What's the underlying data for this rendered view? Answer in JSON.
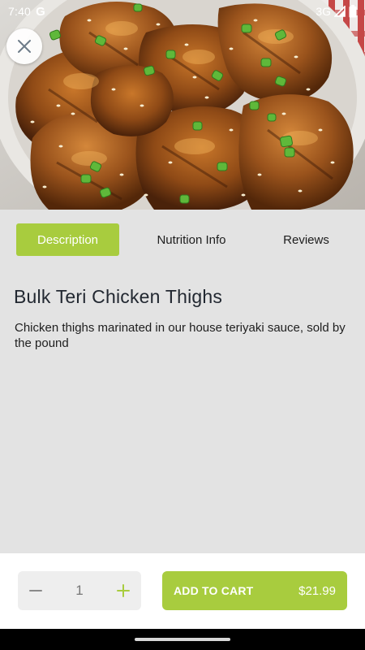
{
  "status_bar": {
    "time": "7:40",
    "g_label": "G",
    "network": "3G"
  },
  "header": {
    "close_icon": "close-icon"
  },
  "tabs": [
    {
      "label": "Description",
      "active": true
    },
    {
      "label": "Nutrition Info",
      "active": false
    },
    {
      "label": "Reviews",
      "active": false
    }
  ],
  "product": {
    "title": "Bulk Teri Chicken Thighs",
    "description": "Chicken thighs marinated in our house teriyaki sauce, sold by the pound"
  },
  "cart": {
    "quantity": "1",
    "decrement_icon": "minus-icon",
    "increment_icon": "plus-icon",
    "add_label": "ADD TO CART",
    "price": "$21.99"
  },
  "colors": {
    "accent": "#a8cc3e",
    "background": "#e3e3e3",
    "title_text": "#222831"
  }
}
